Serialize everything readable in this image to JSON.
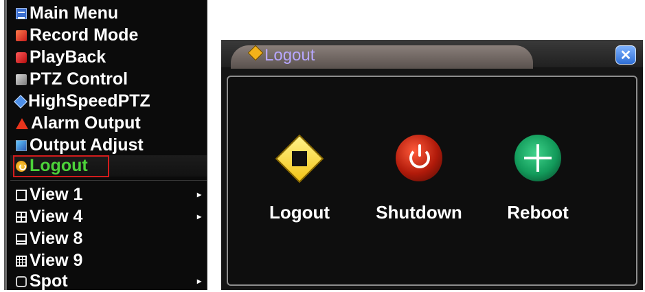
{
  "menu": {
    "items": [
      {
        "label": "Main Menu",
        "icon": "main-menu-icon"
      },
      {
        "label": "Record Mode",
        "icon": "record-mode-icon"
      },
      {
        "label": "PlayBack",
        "icon": "playback-icon"
      },
      {
        "label": "PTZ Control",
        "icon": "ptz-control-icon"
      },
      {
        "label": "HighSpeedPTZ",
        "icon": "highspeed-ptz-icon"
      },
      {
        "label": "Alarm Output",
        "icon": "alarm-output-icon"
      },
      {
        "label": "Output Adjust",
        "icon": "output-adjust-icon"
      },
      {
        "label": "Logout",
        "icon": "power-icon",
        "selected": true
      },
      {
        "label": "View 1",
        "icon": "view-1-icon",
        "submenu_arrow": "▸"
      },
      {
        "label": "View 4",
        "icon": "view-4-icon",
        "submenu_arrow": "▸"
      },
      {
        "label": "View 8",
        "icon": "view-8-icon"
      },
      {
        "label": "View 9",
        "icon": "view-9-icon"
      },
      {
        "label": "Spot",
        "icon": "spot-icon",
        "submenu_arrow": "▸"
      }
    ],
    "selected_highlight_color": "#d21c1c",
    "selected_text_color": "#4cd23a"
  },
  "dialog": {
    "title": "Logout",
    "close_glyph": "✕",
    "actions": [
      {
        "label": "Logout",
        "icon": "logout-exit-sign-icon"
      },
      {
        "label": "Shutdown",
        "icon": "power-off-icon"
      },
      {
        "label": "Reboot",
        "icon": "reboot-icon"
      }
    ]
  }
}
